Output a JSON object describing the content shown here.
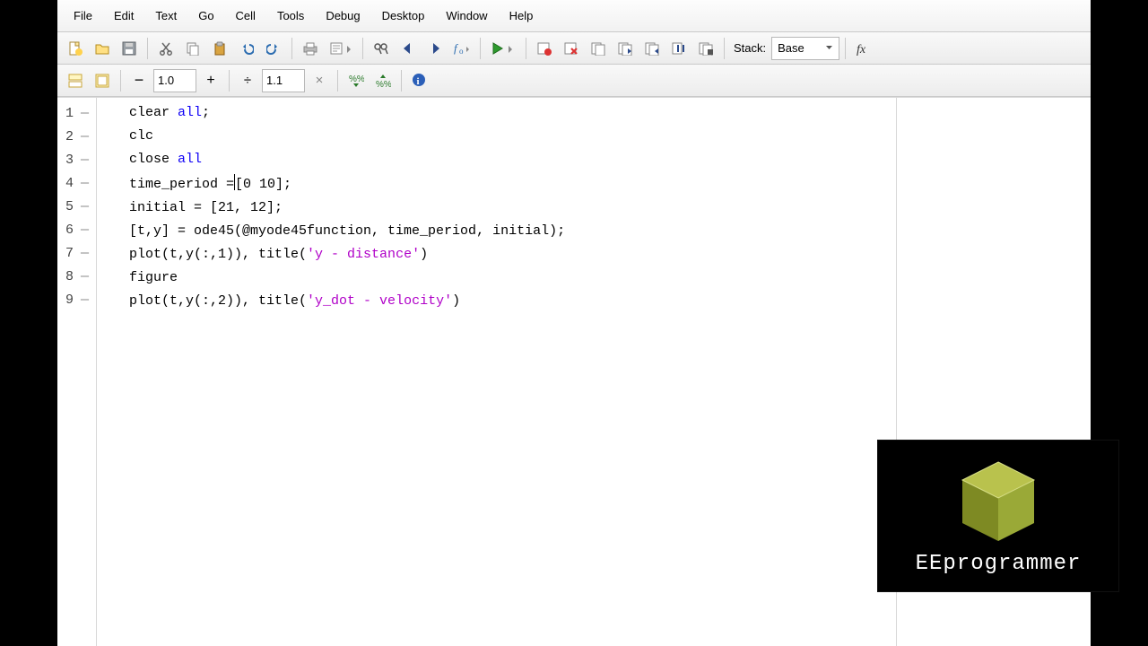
{
  "menubar": {
    "items": [
      "File",
      "Edit",
      "Text",
      "Go",
      "Cell",
      "Tools",
      "Debug",
      "Desktop",
      "Window",
      "Help"
    ]
  },
  "toolbar1": {
    "stack_label": "Stack:",
    "stack_value": "Base"
  },
  "toolbar2": {
    "zoom_out": "−",
    "zoom_value": "1.0",
    "zoom_in": "+",
    "div_sign": "÷",
    "div_value": "1.1",
    "div_clear": "×"
  },
  "code": {
    "lines": [
      {
        "n": "1"
      },
      {
        "n": "2"
      },
      {
        "n": "3"
      },
      {
        "n": "4"
      },
      {
        "n": "5"
      },
      {
        "n": "6"
      },
      {
        "n": "7"
      },
      {
        "n": "8"
      },
      {
        "n": "9"
      }
    ],
    "l1_a": "clear ",
    "l1_kw": "all",
    "l1_b": ";",
    "l2": "clc",
    "l3_a": "close ",
    "l3_kw": "all",
    "l4_a": "time_period =",
    "l4_b": "[0 10];",
    "l5": "initial = [21, 12];",
    "l6": "[t,y] = ode45(@myode45function, time_period, initial);",
    "l7_a": "plot(t,y(:,1)), title(",
    "l7_s": "'y - distance'",
    "l7_b": ")",
    "l8": "figure",
    "l9_a": "plot(t,y(:,2)), title(",
    "l9_s": "'y_dot - velocity'",
    "l9_b": ")"
  },
  "watermark": {
    "label": "EEprogrammer"
  }
}
